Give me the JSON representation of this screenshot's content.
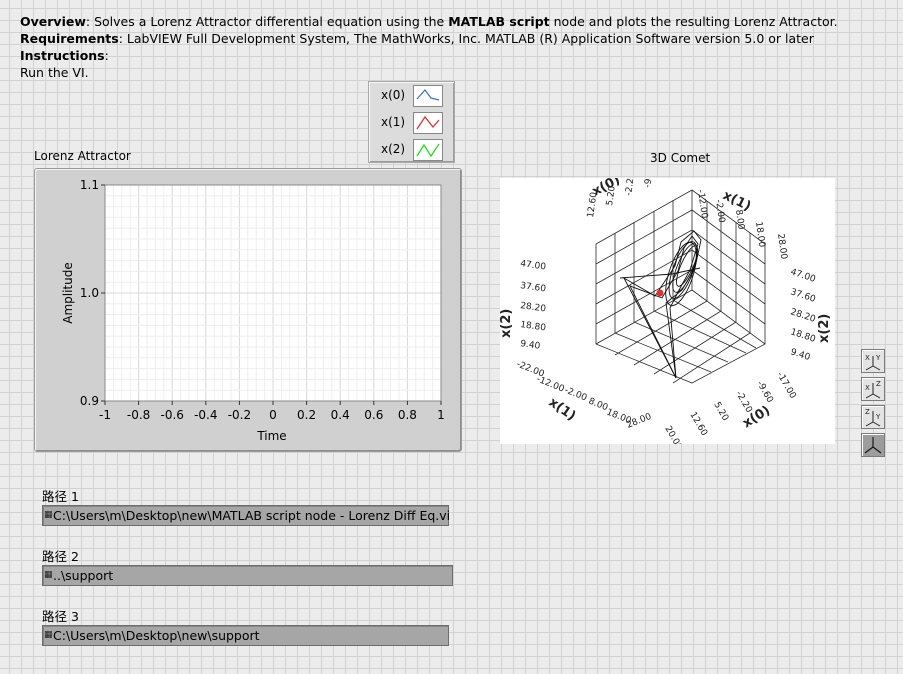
{
  "description": {
    "overview_label": "Overview",
    "overview_pre": ": Solves a Lorenz Attractor differential equation using the ",
    "overview_bold": "MATLAB script",
    "overview_post": " node and plots the resulting Lorenz Attractor.",
    "requirements_label": "Requirements",
    "requirements_text": ": LabVIEW Full Development System, The MathWorks, Inc. MATLAB (R) Application Software version 5.0 or later",
    "instructions_label": "Instructions",
    "instructions_colon": ":",
    "run_text": "Run the VI."
  },
  "legend": {
    "items": [
      {
        "label": "x(0)",
        "color": "#3a78c8"
      },
      {
        "label": "x(1)",
        "color": "#e23030"
      },
      {
        "label": "x(2)",
        "color": "#22dd22"
      }
    ]
  },
  "graph": {
    "title": "Lorenz Attractor",
    "xlabel": "Time",
    "ylabel": "Amplitude"
  },
  "chart_data": {
    "type": "line",
    "title": "Lorenz Attractor",
    "xlabel": "Time",
    "ylabel": "Amplitude",
    "xlim": [
      -1,
      1
    ],
    "ylim": [
      0.9,
      1.1
    ],
    "x_ticks": [
      "-1",
      "-0.8",
      "-0.6",
      "-0.4",
      "-0.2",
      "0",
      "0.2",
      "0.4",
      "0.6",
      "0.8",
      "1"
    ],
    "y_ticks": [
      "0.9",
      "1.0",
      "1.1"
    ],
    "grid": true,
    "series": [
      {
        "name": "x(0)",
        "values": []
      },
      {
        "name": "x(1)",
        "values": []
      },
      {
        "name": "x(2)",
        "values": []
      }
    ]
  },
  "comet": {
    "title": "3D Comet",
    "axis_x0_top": "x(0)",
    "axis_x1_top": "x(1)",
    "axis_x2_left": "x(2)",
    "axis_x2_right": "x(2)",
    "axis_x1_bottom": "x(1)",
    "axis_x0_bottom": "x(0)",
    "z_ticks_left": [
      "47.00",
      "37.60",
      "28.20",
      "18.80",
      "9.40"
    ],
    "z_ticks_right": [
      "47.00",
      "37.60",
      "28.20",
      "18.80",
      "9.40"
    ],
    "x1_ticks_bottom": [
      "-22.00",
      "-12.00",
      "-2.00",
      "8.00",
      "18.00",
      "28.00"
    ],
    "x0_ticks_bottom": [
      "20.00",
      "12.60",
      "5.20",
      "-2.20",
      "-9.60",
      "-17.00"
    ],
    "x0_ticks_top": [
      "-9.60",
      "-2.20",
      "5.20",
      "12.60"
    ],
    "x1_ticks_top": [
      "-12.00",
      "-2.00",
      "8.00",
      "18.00",
      "28.00"
    ],
    "tools": [
      {
        "icon": "rotate-xy-icon"
      },
      {
        "icon": "rotate-xz-icon"
      },
      {
        "icon": "rotate-yz-icon"
      },
      {
        "icon": "reset-view-icon"
      }
    ]
  },
  "paths": [
    {
      "label": "路径 1",
      "value": "C:\\Users\\m\\Desktop\\new\\MATLAB script node - Lorenz Diff Eq.vi"
    },
    {
      "label": "路径 2",
      "value": "..\\support"
    },
    {
      "label": "路径 3",
      "value": "C:\\Users\\m\\Desktop\\new\\support"
    }
  ]
}
